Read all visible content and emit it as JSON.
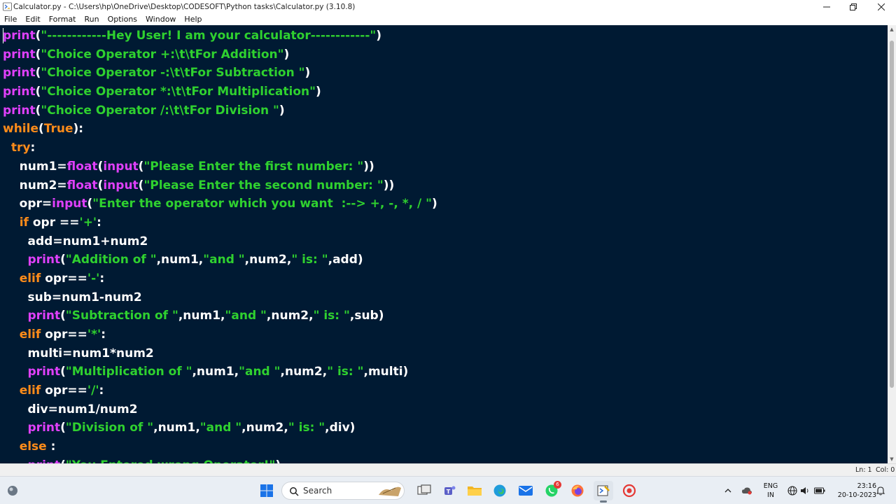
{
  "window": {
    "title": "Calculator.py - C:\\Users\\hp\\OneDrive\\Desktop\\CODESOFT\\Python tasks\\Calculator.py (3.10.8)"
  },
  "menu": [
    "File",
    "Edit",
    "Format",
    "Run",
    "Options",
    "Window",
    "Help"
  ],
  "code_lines": [
    [
      [
        "kw-print",
        "print"
      ],
      [
        "plain",
        "("
      ],
      [
        "str",
        "\"------------Hey User! I am your calculator------------\""
      ],
      [
        "plain",
        ")"
      ]
    ],
    [
      [
        "kw-print",
        "print"
      ],
      [
        "plain",
        "("
      ],
      [
        "str",
        "\"Choice Operator +:\\t\\tFor Addition\""
      ],
      [
        "plain",
        ")"
      ]
    ],
    [
      [
        "kw-print",
        "print"
      ],
      [
        "plain",
        "("
      ],
      [
        "str",
        "\"Choice Operator -:\\t\\tFor Subtraction \""
      ],
      [
        "plain",
        ")"
      ]
    ],
    [
      [
        "kw-print",
        "print"
      ],
      [
        "plain",
        "("
      ],
      [
        "str",
        "\"Choice Operator *:\\t\\tFor Multiplication\""
      ],
      [
        "plain",
        ")"
      ]
    ],
    [
      [
        "kw-print",
        "print"
      ],
      [
        "plain",
        "("
      ],
      [
        "str",
        "\"Choice Operator /:\\t\\tFor Division \""
      ],
      [
        "plain",
        ")"
      ]
    ],
    [
      [
        "kw",
        "while"
      ],
      [
        "plain",
        "("
      ],
      [
        "kw",
        "True"
      ],
      [
        "plain",
        "):"
      ]
    ],
    [
      [
        "plain",
        "  "
      ],
      [
        "kw",
        "try"
      ],
      [
        "plain",
        ":"
      ]
    ],
    [
      [
        "plain",
        "    num1="
      ],
      [
        "fn",
        "float"
      ],
      [
        "plain",
        "("
      ],
      [
        "fn",
        "input"
      ],
      [
        "plain",
        "("
      ],
      [
        "str",
        "\"Please Enter the first number: \""
      ],
      [
        "plain",
        "))"
      ]
    ],
    [
      [
        "plain",
        "    num2="
      ],
      [
        "fn",
        "float"
      ],
      [
        "plain",
        "("
      ],
      [
        "fn",
        "input"
      ],
      [
        "plain",
        "("
      ],
      [
        "str",
        "\"Please Enter the second number: \""
      ],
      [
        "plain",
        "))"
      ]
    ],
    [
      [
        "plain",
        "    opr="
      ],
      [
        "fn",
        "input"
      ],
      [
        "plain",
        "("
      ],
      [
        "str",
        "\"Enter the operator which you want  :--> +, -, *, / \""
      ],
      [
        "plain",
        ")"
      ]
    ],
    [
      [
        "plain",
        "    "
      ],
      [
        "kw",
        "if"
      ],
      [
        "plain",
        " opr =="
      ],
      [
        "str",
        "'+'"
      ],
      [
        "plain",
        ":"
      ]
    ],
    [
      [
        "plain",
        "      add=num1+num2"
      ]
    ],
    [
      [
        "plain",
        "      "
      ],
      [
        "kw-print",
        "print"
      ],
      [
        "plain",
        "("
      ],
      [
        "str",
        "\"Addition of \""
      ],
      [
        "plain",
        ",num1,"
      ],
      [
        "str",
        "\"and \""
      ],
      [
        "plain",
        ",num2,"
      ],
      [
        "str",
        "\" is: \""
      ],
      [
        "plain",
        ",add)"
      ]
    ],
    [
      [
        "plain",
        "    "
      ],
      [
        "kw",
        "elif"
      ],
      [
        "plain",
        " opr=="
      ],
      [
        "str",
        "'-'"
      ],
      [
        "plain",
        ":"
      ]
    ],
    [
      [
        "plain",
        "      sub=num1-num2"
      ]
    ],
    [
      [
        "plain",
        "      "
      ],
      [
        "kw-print",
        "print"
      ],
      [
        "plain",
        "("
      ],
      [
        "str",
        "\"Subtraction of \""
      ],
      [
        "plain",
        ",num1,"
      ],
      [
        "str",
        "\"and \""
      ],
      [
        "plain",
        ",num2,"
      ],
      [
        "str",
        "\" is: \""
      ],
      [
        "plain",
        ",sub)"
      ]
    ],
    [
      [
        "plain",
        "    "
      ],
      [
        "kw",
        "elif"
      ],
      [
        "plain",
        " opr=="
      ],
      [
        "str",
        "'*'"
      ],
      [
        "plain",
        ":"
      ]
    ],
    [
      [
        "plain",
        "      multi=num1*num2"
      ]
    ],
    [
      [
        "plain",
        "      "
      ],
      [
        "kw-print",
        "print"
      ],
      [
        "plain",
        "("
      ],
      [
        "str",
        "\"Multiplication of \""
      ],
      [
        "plain",
        ",num1,"
      ],
      [
        "str",
        "\"and \""
      ],
      [
        "plain",
        ",num2,"
      ],
      [
        "str",
        "\" is: \""
      ],
      [
        "plain",
        ",multi)"
      ]
    ],
    [
      [
        "plain",
        "    "
      ],
      [
        "kw",
        "elif"
      ],
      [
        "plain",
        " opr=="
      ],
      [
        "str",
        "'/'"
      ],
      [
        "plain",
        ":"
      ]
    ],
    [
      [
        "plain",
        "      div=num1/num2"
      ]
    ],
    [
      [
        "plain",
        "      "
      ],
      [
        "kw-print",
        "print"
      ],
      [
        "plain",
        "("
      ],
      [
        "str",
        "\"Division of \""
      ],
      [
        "plain",
        ",num1,"
      ],
      [
        "str",
        "\"and \""
      ],
      [
        "plain",
        ",num2,"
      ],
      [
        "str",
        "\" is: \""
      ],
      [
        "plain",
        ",div)"
      ]
    ],
    [
      [
        "plain",
        "    "
      ],
      [
        "kw",
        "else"
      ],
      [
        "plain",
        " :"
      ]
    ],
    [
      [
        "plain",
        "      "
      ],
      [
        "kw-print",
        "print"
      ],
      [
        "plain",
        "("
      ],
      [
        "str",
        "\"You Entered wrong Operator!\""
      ],
      [
        "plain",
        ")"
      ]
    ]
  ],
  "status": {
    "ln": "Ln: 1",
    "col": "Col: 0"
  },
  "taskbar": {
    "search_label": "Search",
    "lang_top": "ENG",
    "lang_bottom": "IN",
    "time": "23:16",
    "date": "20-10-2023",
    "whatsapp_badge": "6"
  },
  "colors": {
    "editor_bg": "#001a33",
    "keyword": "#ff8c1a",
    "builtin": "#e040fb",
    "string": "#2fd12f",
    "text": "#ffffff"
  }
}
